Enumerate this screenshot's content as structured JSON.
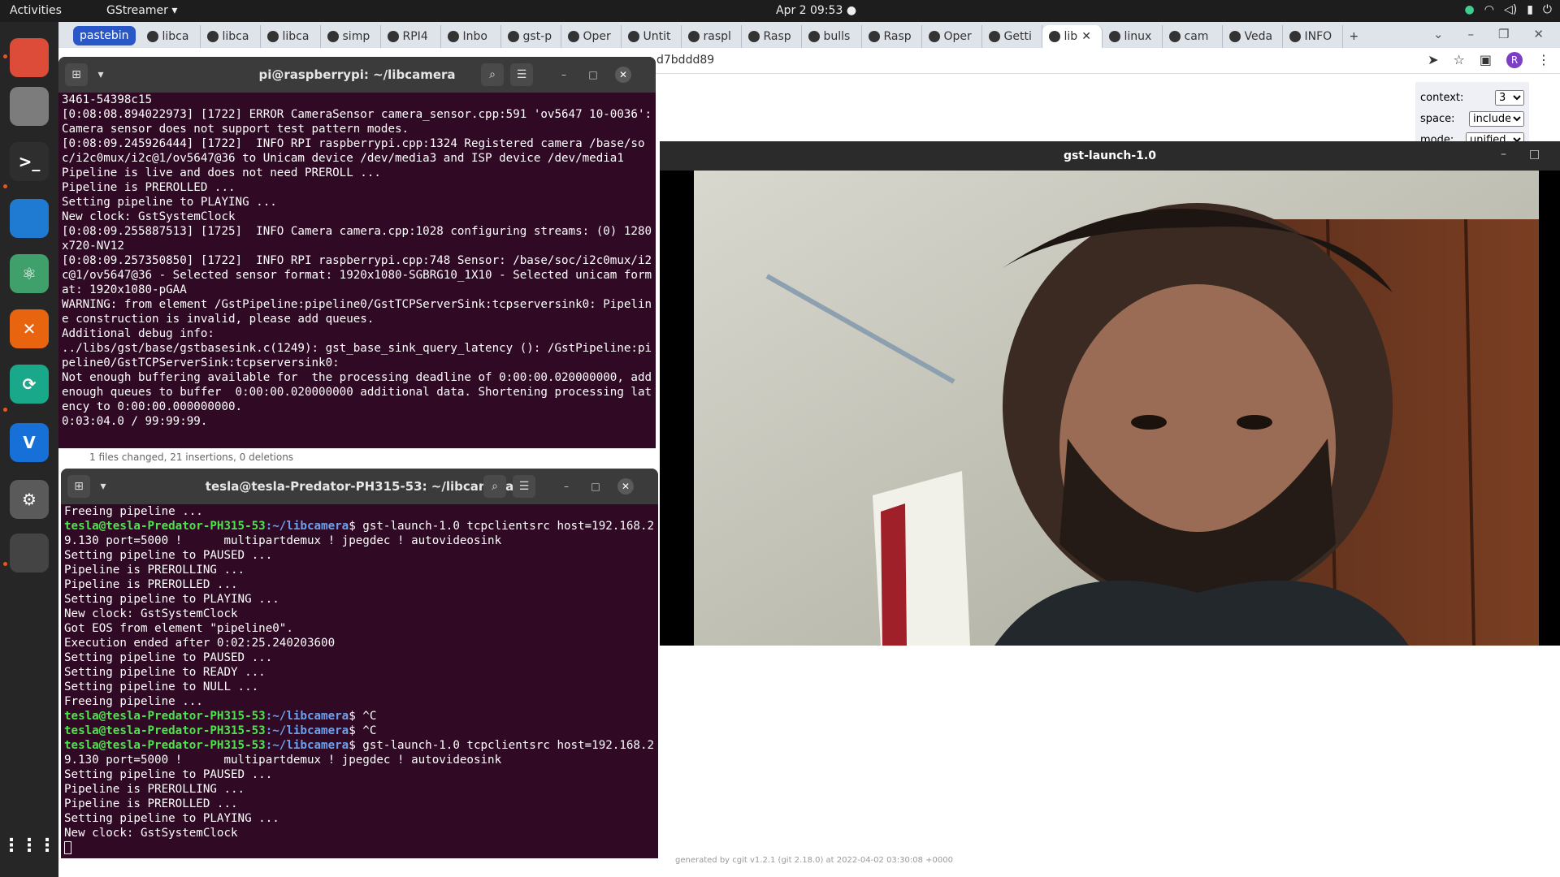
{
  "topbar": {
    "activities": "Activities",
    "app_menu": "GStreamer ▾",
    "clock": "Apr 2  09:53  ●",
    "tray": [
      "wifi-icon",
      "volume-icon",
      "battery-icon",
      "power-icon"
    ]
  },
  "dock": {
    "apps": [
      {
        "name": "chrome",
        "letter": "",
        "color": "#dd4b39"
      },
      {
        "name": "files",
        "letter": "",
        "color": "#7c7c7c"
      },
      {
        "name": "terminal",
        "letter": ">_",
        "color": "#2e2e2e"
      },
      {
        "name": "vscode",
        "letter": "",
        "color": "#1f7bd1"
      },
      {
        "name": "atom",
        "letter": "⚛",
        "color": "#3fa06b"
      },
      {
        "name": "cross",
        "letter": "✕",
        "color": "#e8640e"
      },
      {
        "name": "sync",
        "letter": "⟳",
        "color": "#1aa88b"
      },
      {
        "name": "vnc",
        "letter": "V",
        "color": "#1670d8"
      },
      {
        "name": "settings",
        "letter": "⚙",
        "color": "#5a5a5a"
      },
      {
        "name": "blank",
        "letter": "",
        "color": "#444"
      }
    ],
    "grid_label": "⋮⋮⋮"
  },
  "browser": {
    "tabs": [
      {
        "label": "pastebin",
        "pinned": true
      },
      {
        "label": "libca",
        "pinned": false
      },
      {
        "label": "libca",
        "pinned": false
      },
      {
        "label": "libca",
        "pinned": false
      },
      {
        "label": "simp",
        "pinned": false
      },
      {
        "label": "RPI4",
        "pinned": false
      },
      {
        "label": "Inbo",
        "pinned": false
      },
      {
        "label": "gst-p",
        "pinned": false
      },
      {
        "label": "Oper",
        "pinned": false
      },
      {
        "label": "Untit",
        "pinned": false
      },
      {
        "label": "raspl",
        "pinned": false
      },
      {
        "label": "Rasp",
        "pinned": false
      },
      {
        "label": "bulls",
        "pinned": false
      },
      {
        "label": "Rasp",
        "pinned": false
      },
      {
        "label": "Oper",
        "pinned": false
      },
      {
        "label": "Getti",
        "pinned": false
      },
      {
        "label": "lib",
        "pinned": false,
        "active": true
      },
      {
        "label": "linux",
        "pinned": false
      },
      {
        "label": "cam",
        "pinned": false
      },
      {
        "label": "Veda",
        "pinned": false
      },
      {
        "label": "INFO",
        "pinned": false
      }
    ],
    "url_fragment": "d7bddd89",
    "avatar_letter": "R",
    "diff_options": {
      "context_label": "context:",
      "context_value": "3",
      "space_label": "space:",
      "space_value": "include",
      "mode_label": "mode:",
      "mode_value": "unified"
    },
    "footer": "generated by cgit v1.2.1 (git 2.18.0) at 2022-04-02 03:30:08 +0000"
  },
  "term1": {
    "title": "pi@raspberrypi: ~/libcamera",
    "lines": [
      "3461-54398c15",
      "[0:08:08.894022973] [1722] ERROR CameraSensor camera_sensor.cpp:591 'ov5647 10-0036': Camera sensor does not support test pattern modes.",
      "[0:08:09.245926444] [1722]  INFO RPI raspberrypi.cpp:1324 Registered camera /base/soc/i2c0mux/i2c@1/ov5647@36 to Unicam device /dev/media3 and ISP device /dev/media1",
      "Pipeline is live and does not need PREROLL ...",
      "Pipeline is PREROLLED ...",
      "Setting pipeline to PLAYING ...",
      "New clock: GstSystemClock",
      "[0:08:09.255887513] [1725]  INFO Camera camera.cpp:1028 configuring streams: (0) 1280x720-NV12",
      "[0:08:09.257350850] [1722]  INFO RPI raspberrypi.cpp:748 Sensor: /base/soc/i2c0mux/i2c@1/ov5647@36 - Selected sensor format: 1920x1080-SGBRG10_1X10 - Selected unicam format: 1920x1080-pGAA",
      "WARNING: from element /GstPipeline:pipeline0/GstTCPServerSink:tcpserversink0: Pipeline construction is invalid, please add queues.",
      "Additional debug info:",
      "../libs/gst/base/gstbasesink.c(1249): gst_base_sink_query_latency (): /GstPipeline:pipeline0/GstTCPServerSink:tcpserversink0:",
      "Not enough buffering available for  the processing deadline of 0:00:00.020000000, add enough queues to buffer  0:00:00.020000000 additional data. Shortening processing latency to 0:00:00.000000000.",
      "0:03:04.0 / 99:99:99."
    ]
  },
  "commit_line": "1 files changed, 21 insertions, 0 deletions",
  "term2": {
    "title": "tesla@tesla-Predator-PH315-53: ~/libcamera",
    "prompt_user": "tesla@tesla-Predator-PH315-53",
    "prompt_path": ":~/libcamera",
    "lines": [
      {
        "type": "out",
        "text": "Freeing pipeline ..."
      },
      {
        "type": "cmd",
        "text": "$ gst-launch-1.0 tcpclientsrc host=192.168.29.130 port=5000 !      multipartdemux ! jpegdec ! autovideosink"
      },
      {
        "type": "out",
        "text": "Setting pipeline to PAUSED ..."
      },
      {
        "type": "out",
        "text": "Pipeline is PREROLLING ..."
      },
      {
        "type": "out",
        "text": "Pipeline is PREROLLED ..."
      },
      {
        "type": "out",
        "text": "Setting pipeline to PLAYING ..."
      },
      {
        "type": "out",
        "text": "New clock: GstSystemClock"
      },
      {
        "type": "out",
        "text": "Got EOS from element \"pipeline0\"."
      },
      {
        "type": "out",
        "text": "Execution ended after 0:02:25.240203600"
      },
      {
        "type": "out",
        "text": "Setting pipeline to PAUSED ..."
      },
      {
        "type": "out",
        "text": "Setting pipeline to READY ..."
      },
      {
        "type": "out",
        "text": "Setting pipeline to NULL ..."
      },
      {
        "type": "out",
        "text": "Freeing pipeline ..."
      },
      {
        "type": "cmd",
        "text": "$ ^C"
      },
      {
        "type": "cmd",
        "text": "$ ^C"
      },
      {
        "type": "cmd",
        "text": "$ gst-launch-1.0 tcpclientsrc host=192.168.29.130 port=5000 !      multipartdemux ! jpegdec ! autovideosink"
      },
      {
        "type": "out",
        "text": "Setting pipeline to PAUSED ..."
      },
      {
        "type": "out",
        "text": "Pipeline is PREROLLING ..."
      },
      {
        "type": "out",
        "text": "Pipeline is PREROLLED ..."
      },
      {
        "type": "out",
        "text": "Setting pipeline to PLAYING ..."
      },
      {
        "type": "out",
        "text": "New clock: GstSystemClock"
      }
    ]
  },
  "gstwin": {
    "title": "gst-launch-1.0"
  }
}
